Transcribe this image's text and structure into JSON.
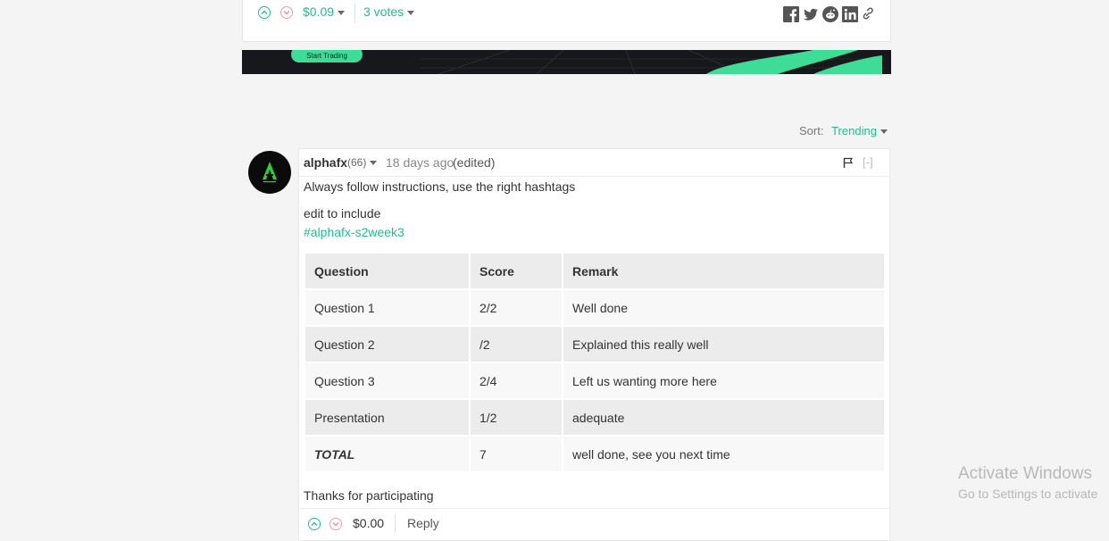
{
  "post": {
    "payout": "$0.09",
    "votes_label": "3 votes",
    "share_icons": [
      "facebook-icon",
      "twitter-icon",
      "reddit-icon",
      "linkedin-icon",
      "link-icon"
    ]
  },
  "ad": {
    "cta_label": "Start Trading"
  },
  "sort": {
    "label": "Sort:",
    "value": "Trending"
  },
  "comment": {
    "author": "alphafx",
    "reputation": "(66)",
    "time": "18 days ago",
    "edited": "(edited)",
    "collapse": "[-]",
    "lines": {
      "intro": "Always follow instructions, use the right hashtags",
      "edit_note": "edit to include",
      "hashtag": "#alphafx-s2week3",
      "closing": "Thanks for participating"
    },
    "table": {
      "headers": [
        "Question",
        "Score",
        "Remark"
      ],
      "rows": [
        [
          "Question 1",
          "2/2",
          "Well done"
        ],
        [
          "Question 2",
          "/2",
          "Explained this really well"
        ],
        [
          "Question 3",
          "2/4",
          "Left us wanting more here"
        ],
        [
          "Presentation",
          "1/2",
          "adequate"
        ],
        [
          "TOTAL",
          "7",
          "well done, see you next time"
        ]
      ]
    },
    "payout": "$0.00",
    "reply_label": "Reply"
  },
  "watermark": {
    "title": "Activate Windows",
    "subtitle": "Go to Settings to activate"
  }
}
